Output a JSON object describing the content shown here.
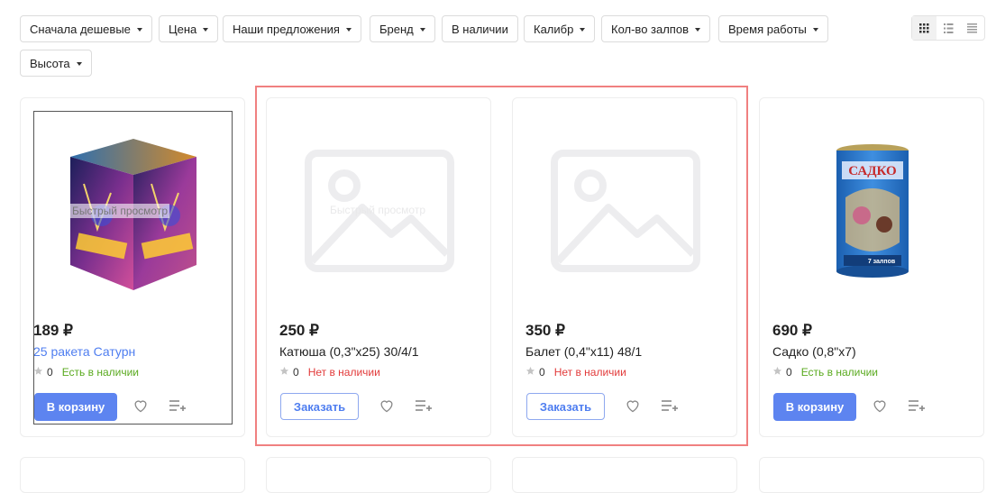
{
  "filters": [
    {
      "label": "Сначала дешевые",
      "caret": true
    },
    {
      "label": "Цена",
      "caret": true
    },
    {
      "label": "Наши предложения",
      "caret": true
    },
    {
      "label": "Бренд",
      "caret": true
    },
    {
      "label": "В наличии",
      "caret": false
    },
    {
      "label": "Калибр",
      "caret": true
    },
    {
      "label": "Кол-во залпов",
      "caret": true
    },
    {
      "label": "Время работы",
      "caret": true
    },
    {
      "label": "Высота",
      "caret": true
    }
  ],
  "view_modes": [
    "grid-view-icon",
    "list-view-icon",
    "compact-list-view-icon"
  ],
  "products": [
    {
      "price": "189 ₽",
      "title": "25 ракета Сатурн",
      "title_is_link": true,
      "rating": "0",
      "stock": "Есть в наличии",
      "in_stock": true,
      "button": "В корзину",
      "quick_view": "Быстрый просмотр",
      "image": "fireworks-box-saturn"
    },
    {
      "price": "250 ₽",
      "title": "Катюша (0,3\"х25) 30/4/1",
      "title_is_link": false,
      "rating": "0",
      "stock": "Нет в наличии",
      "in_stock": false,
      "button": "Заказать",
      "quick_view": "Быстрый просмотр",
      "image": "image-placeholder-icon"
    },
    {
      "price": "350 ₽",
      "title": "Балет (0,4\"х11) 48/1",
      "title_is_link": false,
      "rating": "0",
      "stock": "Нет в наличии",
      "in_stock": false,
      "button": "Заказать",
      "image": "image-placeholder-icon"
    },
    {
      "price": "690 ₽",
      "title": "Садко (0,8\"х7)",
      "title_is_link": false,
      "rating": "0",
      "stock": "Есть в наличии",
      "in_stock": true,
      "button": "В корзину",
      "image": "fireworks-cylinder-sadko",
      "image_text": "САДКО",
      "image_badge": "7 залпов"
    }
  ],
  "colors": {
    "accent": "#5d84f0",
    "in_stock": "#5aaa1f",
    "out_of_stock": "#e23b3b",
    "highlight": "#f08080"
  }
}
